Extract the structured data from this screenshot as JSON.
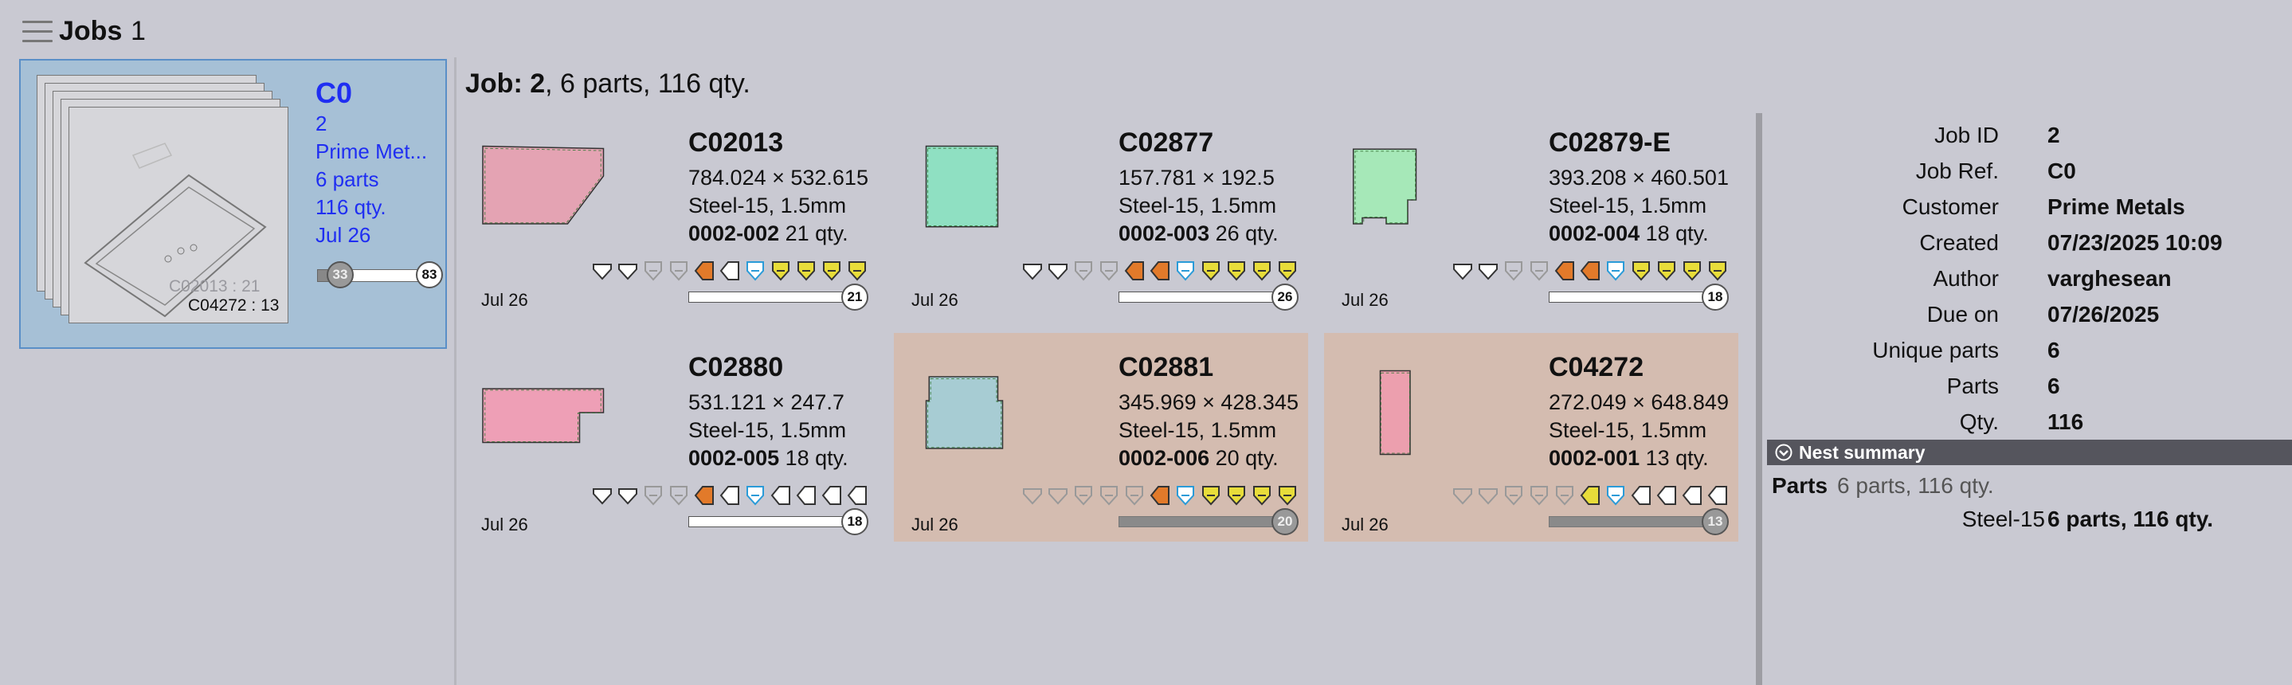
{
  "app": {
    "title": "Jobs",
    "count": "1"
  },
  "job_card": {
    "code": "C0",
    "lines": [
      "2",
      "Prime Met...",
      "6 parts",
      "116 qty.",
      "Jul 26"
    ],
    "slider": {
      "min_label": "33",
      "max_label": "83",
      "progress": 0.15
    },
    "sheet_caption_top": "C02013 : 21",
    "sheet_caption_bottom": "C04272 : 13"
  },
  "job_header": {
    "prefix": "Job: 2",
    "rest": ", 6 parts, 116 qty."
  },
  "parts": [
    {
      "name": "C02013",
      "dims": "784.024 × 532.615",
      "material": "Steel-15, 1.5mm",
      "job_no": "0002-002",
      "qty": "21 qty.",
      "date": "Jul 26",
      "count": "21",
      "highlighted": false,
      "complete": false,
      "thumb_color": "#e4a3b3",
      "icons": [
        "tri",
        "tri",
        "grey",
        "grey",
        "orange",
        "white",
        "blue",
        "yellow",
        "yellow",
        "yellow",
        "yellow"
      ]
    },
    {
      "name": "C02877",
      "dims": "157.781 × 192.5",
      "material": "Steel-15, 1.5mm",
      "job_no": "0002-003",
      "qty": "26 qty.",
      "date": "Jul 26",
      "count": "26",
      "highlighted": false,
      "complete": false,
      "thumb_color": "#8fe0c2",
      "icons": [
        "tri",
        "tri",
        "grey",
        "grey",
        "orange",
        "orange",
        "blue",
        "yellow",
        "yellow",
        "yellow",
        "yellow"
      ]
    },
    {
      "name": "C02879-E",
      "dims": "393.208 × 460.501",
      "material": "Steel-15, 1.5mm",
      "job_no": "0002-004",
      "qty": "18 qty.",
      "date": "Jul 26",
      "count": "18",
      "highlighted": false,
      "complete": false,
      "thumb_color": "#a6e8b8",
      "icons": [
        "tri",
        "tri",
        "grey",
        "grey",
        "orange",
        "orange",
        "blue",
        "yellow",
        "yellow",
        "yellow",
        "yellow"
      ]
    },
    {
      "name": "C02880",
      "dims": "531.121 × 247.7",
      "material": "Steel-15, 1.5mm",
      "job_no": "0002-005",
      "qty": "18 qty.",
      "date": "Jul 26",
      "count": "18",
      "highlighted": false,
      "complete": false,
      "thumb_color": "#ee9fb6",
      "icons": [
        "tri",
        "tri",
        "grey",
        "grey",
        "orange",
        "white",
        "blue",
        "white",
        "white",
        "white",
        "white"
      ]
    },
    {
      "name": "C02881",
      "dims": "345.969 × 428.345",
      "material": "Steel-15, 1.5mm",
      "job_no": "0002-006",
      "qty": "20 qty.",
      "date": "Jul 26",
      "count": "20",
      "highlighted": true,
      "complete": true,
      "thumb_color": "#a7ccd3",
      "icons": [
        "greytri",
        "greytri",
        "grey",
        "grey",
        "grey",
        "orange",
        "blue",
        "yellow",
        "yellow",
        "yellow",
        "yellow"
      ]
    },
    {
      "name": "C04272",
      "dims": "272.049 × 648.849",
      "material": "Steel-15, 1.5mm",
      "job_no": "0002-001",
      "qty": "13 qty.",
      "date": "Jul 26",
      "count": "13",
      "highlighted": true,
      "complete": true,
      "thumb_color": "#ec9fae",
      "icons": [
        "greytri",
        "greytri",
        "grey",
        "grey",
        "grey",
        "yellowl",
        "blue",
        "white",
        "white",
        "white",
        "white"
      ]
    }
  ],
  "info": [
    {
      "label": "Job ID",
      "value": "2"
    },
    {
      "label": "Job Ref.",
      "value": "C0"
    },
    {
      "label": "Customer",
      "value": "Prime Metals"
    },
    {
      "label": "Created",
      "value": "07/23/2025 10:09"
    },
    {
      "label": "Author",
      "value": "varghesean"
    },
    {
      "label": "Due on",
      "value": "07/26/2025"
    },
    {
      "label": "Unique parts",
      "value": "6"
    },
    {
      "label": "Parts",
      "value": "6"
    },
    {
      "label": "Qty.",
      "value": "116"
    }
  ],
  "nest_summary": {
    "title": "Nest summary",
    "parts_label": "Parts",
    "parts_value": "6 parts, 116 qty.",
    "material_label": "Steel-15",
    "material_value": "6 parts, 116 qty."
  },
  "colors": {
    "selected_card": "#a6c0d6",
    "link_text": "#1f2ef2",
    "highlight_part": "#d4bcb0"
  }
}
